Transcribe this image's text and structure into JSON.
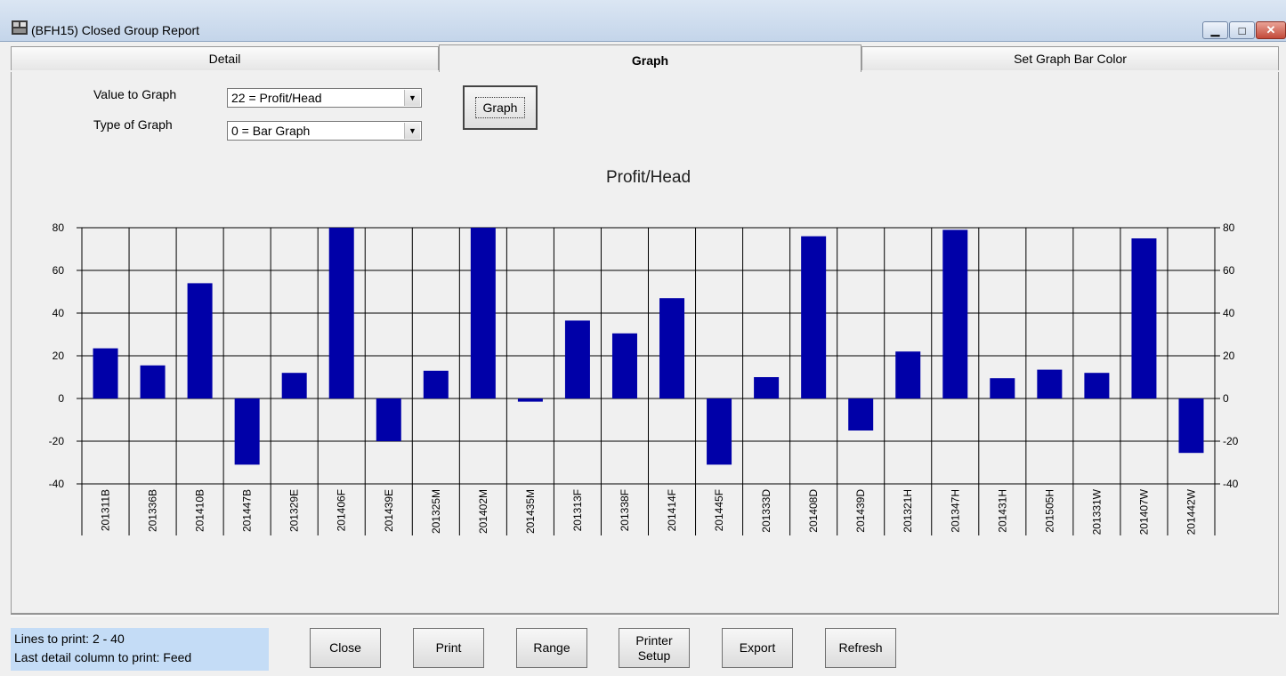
{
  "window": {
    "title": "(BFH15)  Closed Group Report",
    "minimize_glyph": "▁",
    "maximize_glyph": "□",
    "close_glyph": "✕"
  },
  "tabs": [
    {
      "label": "Detail"
    },
    {
      "label": "Graph"
    },
    {
      "label": "Set Graph Bar Color"
    }
  ],
  "controls": {
    "value_label": "Value to Graph",
    "value_selected": "22 = Profit/Head",
    "type_label": "Type of Graph",
    "type_selected": "0 = Bar Graph",
    "graph_button": "Graph",
    "dropdown_glyph": "▼"
  },
  "chart_data": {
    "type": "bar",
    "title": "Profit/Head",
    "bar_color": "#0000a8",
    "ylim": [
      -40,
      80
    ],
    "yticks": [
      80,
      60,
      40,
      20,
      0,
      -20,
      -40
    ],
    "grid": true,
    "categories": [
      "201311B",
      "201336B",
      "201410B",
      "201447B",
      "201329E",
      "201406F",
      "201439E",
      "201325M",
      "201402M",
      "201435M",
      "201313F",
      "201338F",
      "201414F",
      "201445F",
      "201333D",
      "201408D",
      "201439D",
      "201321H",
      "201347H",
      "201431H",
      "201505H",
      "201331W",
      "201407W",
      "201442W"
    ],
    "values": [
      23.5,
      15.5,
      54,
      -31,
      12,
      80,
      -20,
      13,
      80,
      -1.5,
      36.5,
      30.5,
      47,
      -31,
      10,
      76,
      -15,
      22,
      79,
      9.5,
      13.5,
      12,
      75,
      -25.5
    ]
  },
  "status": {
    "line1": "Lines to print: 2 - 40",
    "line2": "Last detail column to print:   Feed"
  },
  "buttons": {
    "close": "Close",
    "print": "Print",
    "range": "Range",
    "printer_setup": "Printer\nSetup",
    "export": "Export",
    "refresh": "Refresh"
  }
}
